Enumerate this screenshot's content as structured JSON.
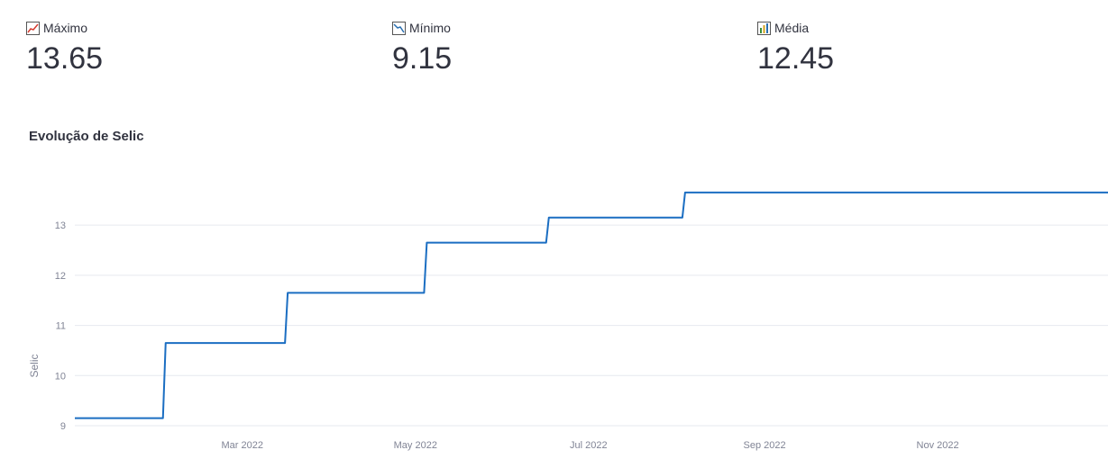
{
  "metrics": [
    {
      "label": "Máximo",
      "value": "13.65",
      "icon": "chart-increasing-icon"
    },
    {
      "label": "Mínimo",
      "value": "9.15",
      "icon": "chart-decreasing-icon"
    },
    {
      "label": "Média",
      "value": "12.45",
      "icon": "bar-chart-icon"
    }
  ],
  "chart_title": "Evolução de Selic",
  "chart_data": {
    "type": "line",
    "line_shape": "step",
    "title": "Evolução de Selic",
    "xlabel": "",
    "ylabel": "Selic",
    "x_range": [
      "2022-01-01",
      "2022-12-31"
    ],
    "ylim": [
      9,
      13.9
    ],
    "y_ticks": [
      9,
      10,
      11,
      12,
      13
    ],
    "x_ticks": [
      {
        "date": "2022-03-01",
        "label": "Mar 2022"
      },
      {
        "date": "2022-05-01",
        "label": "May 2022"
      },
      {
        "date": "2022-07-01",
        "label": "Jul 2022"
      },
      {
        "date": "2022-09-01",
        "label": "Sep 2022"
      },
      {
        "date": "2022-11-01",
        "label": "Nov 2022"
      }
    ],
    "grid": true,
    "series": [
      {
        "color": "#1b6ec2",
        "points": [
          {
            "x": "2022-01-01",
            "y": 9.15
          },
          {
            "x": "2022-02-02",
            "y": 10.65
          },
          {
            "x": "2022-03-17",
            "y": 11.65
          },
          {
            "x": "2022-05-05",
            "y": 12.65
          },
          {
            "x": "2022-06-17",
            "y": 13.15
          },
          {
            "x": "2022-08-04",
            "y": 13.65
          },
          {
            "x": "2022-12-31",
            "y": 13.65
          }
        ]
      }
    ]
  }
}
